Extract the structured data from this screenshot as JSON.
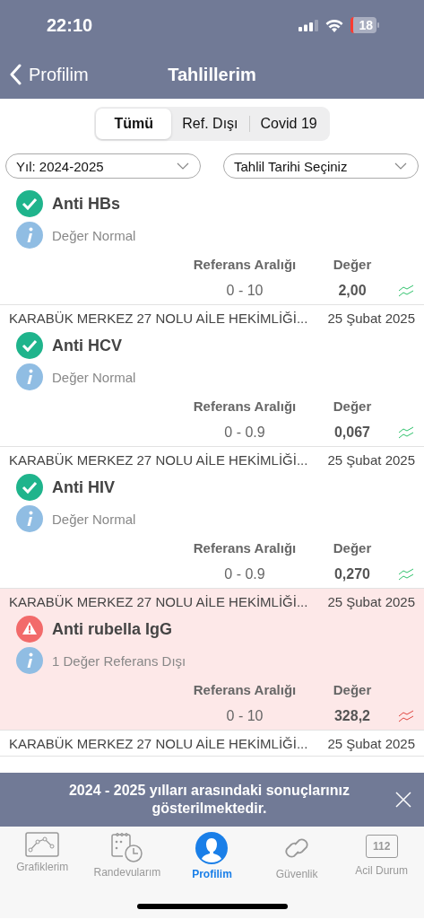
{
  "status_bar": {
    "time": "22:10",
    "battery": "18"
  },
  "nav": {
    "back": "Profilim",
    "title": "Tahlillerim"
  },
  "segments": [
    {
      "label": "Tümü",
      "selected": true
    },
    {
      "label": "Ref. Dışı",
      "selected": false
    },
    {
      "label": "Covid 19",
      "selected": false
    }
  ],
  "filters": [
    {
      "value": "Yıl: 2024-2025"
    },
    {
      "value": "Tahlil Tarihi Seçiniz"
    }
  ],
  "results": [
    {
      "out_of_range": false,
      "name": "Anti HBs",
      "info": "Değer Normal",
      "range_label": "Referans Aralığı",
      "value_label": "Değer",
      "range": "0 - 10",
      "value": "2,00"
    },
    {
      "out_of_range": false,
      "facility": "KARABÜK MERKEZ 27 NOLU AİLE HEKİMLİĞİ...",
      "date": "25 Şubat 2025",
      "name": "Anti HCV",
      "info": "Değer Normal",
      "range_label": "Referans Aralığı",
      "value_label": "Değer",
      "range": "0 - 0.9",
      "value": "0,067"
    },
    {
      "out_of_range": false,
      "facility": "KARABÜK MERKEZ 27 NOLU AİLE HEKİMLİĞİ...",
      "date": "25 Şubat 2025",
      "name": "Anti HIV",
      "info": "Değer Normal",
      "range_label": "Referans Aralığı",
      "value_label": "Değer",
      "range": "0 - 0.9",
      "value": "0,270"
    },
    {
      "out_of_range": true,
      "facility": "KARABÜK MERKEZ 27 NOLU AİLE HEKİMLİĞİ...",
      "date": "25 Şubat 2025",
      "name": "Anti rubella IgG",
      "info": "1 Değer Referans Dışı",
      "range_label": "Referans Aralığı",
      "value_label": "Değer",
      "range": "0 - 10",
      "value": "328,2"
    },
    {
      "out_of_range": false,
      "facility": "KARABÜK MERKEZ 27 NOLU AİLE HEKİMLİĞİ...",
      "date": "25 Şubat 2025"
    }
  ],
  "toast": {
    "message": "2024 - 2025 yılları arasındaki sonuçlarınız gösterilmektedir."
  },
  "tab_bar": [
    {
      "kind": "chart",
      "label": "Grafiklerim",
      "selected": false
    },
    {
      "kind": "calendar",
      "label": "Randevularım",
      "selected": false
    },
    {
      "kind": "person",
      "label": "Profilim",
      "selected": true
    },
    {
      "kind": "link",
      "label": "Güvenlik",
      "selected": false
    },
    {
      "kind": "emergency",
      "label": "Acil Durum",
      "selected": false,
      "badge": "112"
    }
  ]
}
